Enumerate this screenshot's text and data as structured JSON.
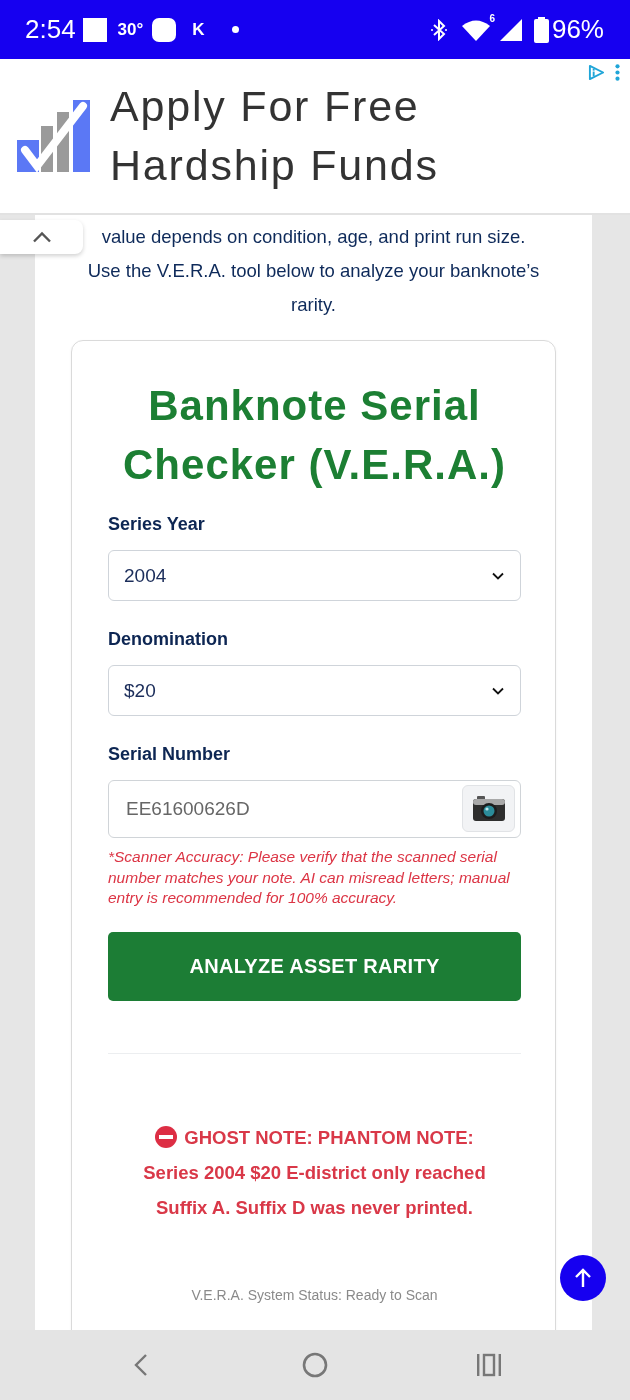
{
  "status_bar": {
    "time": "2:54",
    "temperature": "30°",
    "notification_letter": "K",
    "wifi_badge": "6",
    "battery": "96%"
  },
  "ad": {
    "headline": "Apply For Free Hardship Funds"
  },
  "intro": [
    "value depends on condition, age, and print run size.",
    "Use the V.E.R.A. tool below to analyze your banknote’s rarity."
  ],
  "checker": {
    "title": "Banknote Serial Checker (V.E.R.A.)",
    "fields": [
      {
        "kind": "select",
        "label": "Series Year",
        "value": "2004"
      },
      {
        "kind": "select",
        "label": "Denomination",
        "value": "$20"
      },
      {
        "kind": "scan",
        "label": "Serial Number",
        "value": "EE61600626D"
      }
    ],
    "disclaimer": "*Scanner Accuracy: Please verify that the scanned serial number matches your note. AI can misread letters; manual entry is recommended for 100% accuracy.",
    "submit": "ANALYZE ASSET RARITY",
    "result": {
      "kind": "error",
      "title": "GHOST NOTE: PHANTOM NOTE:",
      "message": "Series 2004 $20 E-district only reached Suffix A. Suffix D was never printed."
    },
    "status": "V.E.R.A. System Status: Ready to Scan"
  }
}
